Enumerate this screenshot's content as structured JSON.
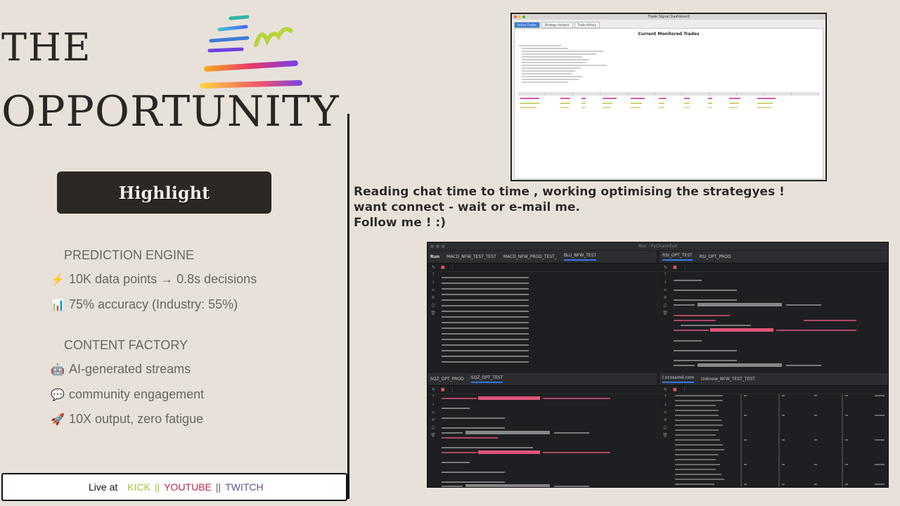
{
  "left": {
    "title_line1": "THE",
    "title_line2": "OPPORTUNITY",
    "highlight": "Highlight",
    "section1": "PREDICTION ENGINE",
    "section1_items": [
      {
        "icon": "⚡",
        "icon_name": "lightning-icon",
        "text": "10K data points → 0.8s decisions"
      },
      {
        "icon": "📊",
        "icon_name": "bar-chart-icon",
        "text": "75% accuracy (Industry: 55%)"
      }
    ],
    "section2": "CONTENT FACTORY",
    "section2_items": [
      {
        "icon": "🤖",
        "icon_name": "robot-icon",
        "text": "AI-generated streams"
      },
      {
        "icon": "💬",
        "icon_name": "speech-bubble-icon",
        "text": "community engagement"
      },
      {
        "icon": "🚀",
        "icon_name": "rocket-icon",
        "text": "10X output, zero fatigue"
      }
    ],
    "live": {
      "label": "Live at",
      "kick": "KICK",
      "sep1": "||",
      "youtube": "YOUTUBE",
      "sep2": "||",
      "twitch": "TWITCH"
    }
  },
  "chat_text": {
    "line1": "Reading chat time to time , working optimising the strategyes !",
    "line2": "want connect - wait or e-mail me.",
    "line3": "Follow me ! :)"
  },
  "dashboard": {
    "title": "Trade Signal Dashboard",
    "tabs": [
      "Active Trades",
      "Strategy Analysis",
      "Trade History"
    ],
    "heading": "Current Monitored Trades"
  },
  "pycharm": {
    "title": "Run - PyCharmFull",
    "run_label": "Run",
    "pane1_tabs": [
      "MACD_NFW_TEST_TEST",
      "MACD_NFW_PROD_TEST_",
      "BLU_NFW_TEST"
    ],
    "pane2_tabs": [
      "RSI_OPT_TEST",
      "RSI_OPT_PROD"
    ],
    "pane3_tabs": [
      "SQZ_OPT_PROD",
      "SQZ_OPT_TEST"
    ],
    "pane4_tabs": [
      "I.ocossmd.com",
      "Unknow_NFW_TEST_TEST"
    ]
  },
  "colors": {
    "kick": "#9acb3a",
    "youtube": "#c02646",
    "twitch": "#6a4f8a",
    "terminal_accent": "#e0557a"
  }
}
